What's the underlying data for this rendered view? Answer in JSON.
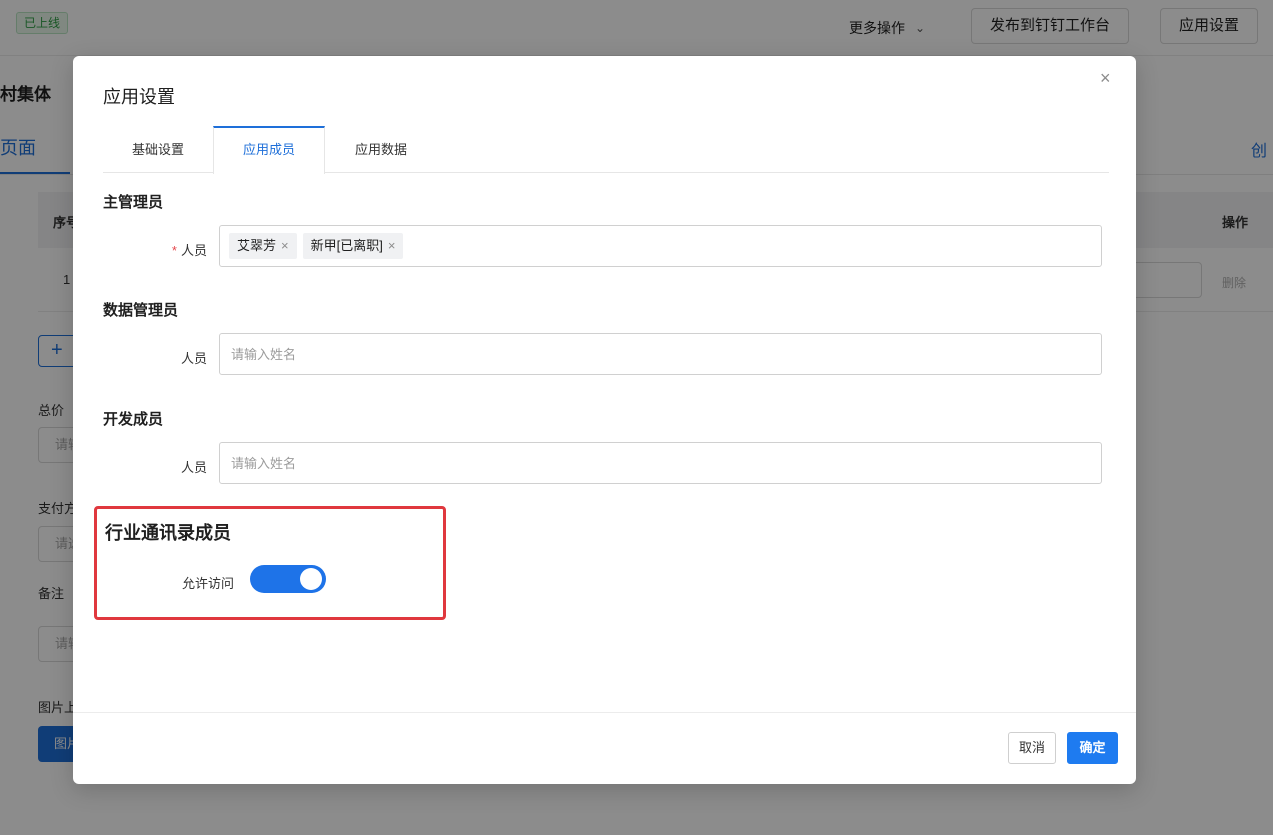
{
  "background": {
    "status_badge": "已上线",
    "more_actions": "更多操作",
    "publish_button": "发布到钉钉工作台",
    "app_settings_button": "应用设置",
    "title": "村集体",
    "active_tab": "页面",
    "create_link": "创",
    "table_headers": {
      "seq": "序号",
      "op": "操作"
    },
    "row": {
      "num": "1",
      "delete": "删除"
    },
    "add_button": "+",
    "fields": [
      {
        "label": "总价",
        "placeholder": "请输入"
      },
      {
        "label": "支付方式",
        "placeholder": "请选择"
      },
      {
        "label": "备注",
        "placeholder": "请输入"
      },
      {
        "label": "图片上传",
        "button": "图片上传"
      }
    ]
  },
  "modal": {
    "title": "应用设置",
    "close": "×",
    "tabs": [
      {
        "label": "基础设置",
        "active": false
      },
      {
        "label": "应用成员",
        "active": true
      },
      {
        "label": "应用数据",
        "active": false
      }
    ],
    "sections": {
      "main_admin": {
        "title": "主管理员",
        "required_mark": "*",
        "label": "人员",
        "tags": [
          "艾翠芳",
          "新甲[已离职]"
        ],
        "tag_remove": "×"
      },
      "data_admin": {
        "title": "数据管理员",
        "label": "人员",
        "placeholder": "请输入姓名"
      },
      "dev_members": {
        "title": "开发成员",
        "label": "人员",
        "placeholder": "请输入姓名"
      },
      "industry_contacts": {
        "title": "行业通讯录成员",
        "label": "允许访问",
        "enabled": true
      }
    },
    "footer": {
      "cancel": "取消",
      "ok": "确定"
    }
  },
  "colors": {
    "primary": "#1e73e8",
    "highlight_border": "#e0383e",
    "required": "#e5484d"
  }
}
